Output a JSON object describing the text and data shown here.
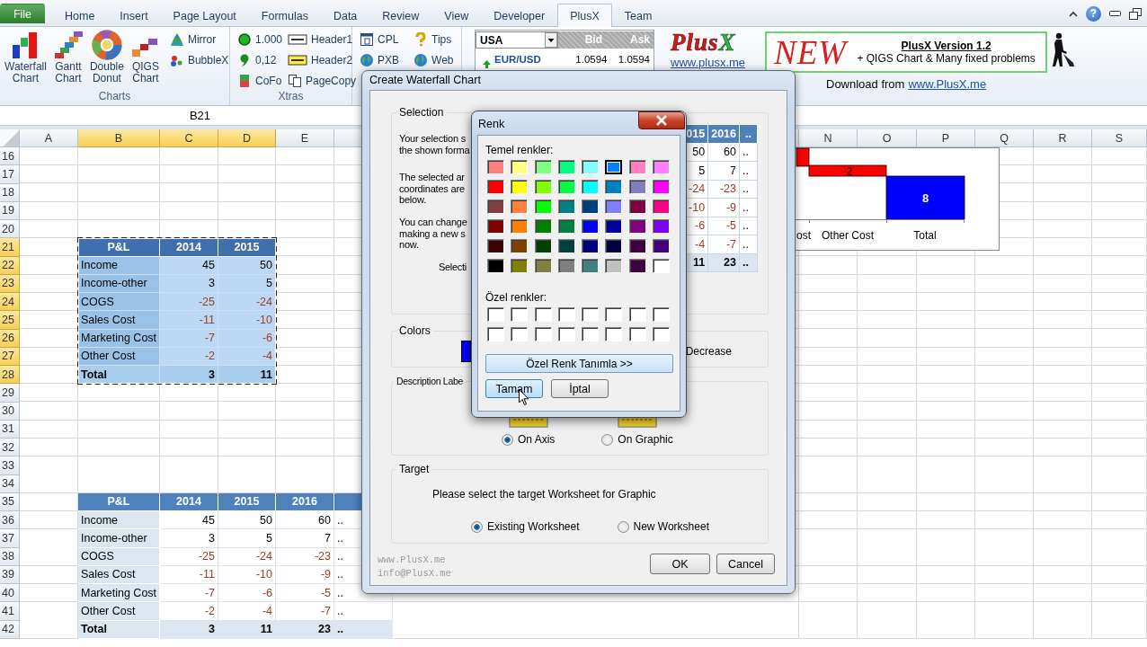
{
  "ribbon": {
    "tabs": [
      {
        "label": "File",
        "kind": "file",
        "selected": false
      },
      {
        "label": "Home",
        "kind": "tab",
        "selected": false
      },
      {
        "label": "Insert",
        "kind": "tab",
        "selected": false
      },
      {
        "label": "Page Layout",
        "kind": "tab",
        "selected": false
      },
      {
        "label": "Formulas",
        "kind": "tab",
        "selected": false
      },
      {
        "label": "Data",
        "kind": "tab",
        "selected": false
      },
      {
        "label": "Review",
        "kind": "tab",
        "selected": false
      },
      {
        "label": "View",
        "kind": "tab",
        "selected": false
      },
      {
        "label": "Developer",
        "kind": "tab",
        "selected": false
      },
      {
        "label": "PlusX",
        "kind": "tab",
        "selected": true
      },
      {
        "label": "Team",
        "kind": "tab",
        "selected": false
      }
    ],
    "help": "?",
    "charts_group": {
      "label": "Charts",
      "large_buttons": [
        "Waterfall Chart",
        "Gantt Chart",
        "Double Donut",
        "QIGS Chart"
      ],
      "small_buttons": [
        "Mirror",
        "BubbleX"
      ]
    },
    "xtras_group": {
      "label": "Xtras",
      "columns": [
        [
          "1.000",
          "0,12",
          "CoFo"
        ],
        [
          "Header1",
          "Header2",
          "PageCopy"
        ]
      ]
    },
    "web_group": {
      "columns": [
        [
          "CPL",
          "PXB"
        ],
        [
          "Tips",
          "Web"
        ]
      ]
    },
    "quote": {
      "market": "USA",
      "columns": [
        "Bid",
        "Ask"
      ],
      "rows": [
        {
          "pair": "EUR/USD",
          "bid": "1.0594",
          "ask": "1.0594"
        }
      ]
    },
    "logo": {
      "name": "PlusX",
      "url": "www.plusx.me"
    },
    "banner": {
      "badge": "NEW",
      "title": "PlusX Version 1.2",
      "subtitle": "+ QIGS Chart & Many fixed problems"
    },
    "download": {
      "prefix": "Download from",
      "link": "www.PlusX.me"
    }
  },
  "name_box": "B21",
  "sheet": {
    "columns": [
      {
        "label": "A",
        "selected": false
      },
      {
        "label": "B",
        "selected": true
      },
      {
        "label": "C",
        "selected": true
      },
      {
        "label": "D",
        "selected": true
      },
      {
        "label": "E",
        "selected": false
      }
    ],
    "columns_right": [
      {
        "label": "N",
        "selected": false
      },
      {
        "label": "O",
        "selected": false
      },
      {
        "label": "P",
        "selected": false
      },
      {
        "label": "Q",
        "selected": false
      },
      {
        "label": "R",
        "selected": false
      },
      {
        "label": "S",
        "selected": false
      }
    ],
    "rows": [
      {
        "label": "16",
        "selected": false
      },
      {
        "label": "17",
        "selected": false
      },
      {
        "label": "18",
        "selected": false
      },
      {
        "label": "19",
        "selected": false
      },
      {
        "label": "20",
        "selected": false
      },
      {
        "label": "21",
        "selected": true
      },
      {
        "label": "22",
        "selected": true
      },
      {
        "label": "23",
        "selected": true
      },
      {
        "label": "24",
        "selected": true
      },
      {
        "label": "25",
        "selected": true
      },
      {
        "label": "26",
        "selected": true
      },
      {
        "label": "27",
        "selected": true
      },
      {
        "label": "28",
        "selected": true
      },
      {
        "label": "29",
        "selected": false
      },
      {
        "label": "30",
        "selected": false
      },
      {
        "label": "31",
        "selected": false
      },
      {
        "label": "32",
        "selected": false
      },
      {
        "label": "33",
        "selected": false
      },
      {
        "label": "34",
        "selected": false
      },
      {
        "label": "35",
        "selected": false
      },
      {
        "label": "36",
        "selected": false
      },
      {
        "label": "37",
        "selected": false
      },
      {
        "label": "38",
        "selected": false
      },
      {
        "label": "39",
        "selected": false
      },
      {
        "label": "40",
        "selected": false
      },
      {
        "label": "41",
        "selected": false
      },
      {
        "label": "42",
        "selected": false
      }
    ],
    "tables": [
      {
        "selected": true,
        "header": [
          "P&L",
          "2014",
          "2015"
        ],
        "rows": [
          {
            "label": "Income",
            "values": [
              "45",
              "50"
            ],
            "negative": false,
            "total": false
          },
          {
            "label": "Income-other",
            "values": [
              "3",
              "5"
            ],
            "negative": false,
            "total": false
          },
          {
            "label": "COGS",
            "values": [
              "-25",
              "-24"
            ],
            "negative": true,
            "total": false
          },
          {
            "label": "Sales Cost",
            "values": [
              "-11",
              "-10"
            ],
            "negative": true,
            "total": false
          },
          {
            "label": "Marketing Cost",
            "values": [
              "-7",
              "-6"
            ],
            "negative": true,
            "total": false
          },
          {
            "label": "Other Cost",
            "values": [
              "-2",
              "-4"
            ],
            "negative": true,
            "total": false
          },
          {
            "label": "Total",
            "values": [
              "3",
              "11"
            ],
            "negative": false,
            "total": true
          }
        ]
      },
      {
        "selected": false,
        "header": [
          "P&L",
          "2014",
          "2015",
          "2016"
        ],
        "rows": [
          {
            "label": "Income",
            "values": [
              "45",
              "50",
              "60",
              ".."
            ],
            "negative": false,
            "total": false
          },
          {
            "label": "Income-other",
            "values": [
              "3",
              "5",
              "7",
              ".."
            ],
            "negative": false,
            "total": false
          },
          {
            "label": "COGS",
            "values": [
              "-25",
              "-24",
              "-23",
              ".."
            ],
            "negative": true,
            "total": false
          },
          {
            "label": "Sales Cost",
            "values": [
              "-11",
              "-10",
              "-9",
              ".."
            ],
            "negative": true,
            "total": false
          },
          {
            "label": "Marketing Cost",
            "values": [
              "-7",
              "-6",
              "-5",
              ".."
            ],
            "negative": true,
            "total": false
          },
          {
            "label": "Other Cost",
            "values": [
              "-2",
              "-4",
              "-7",
              ".."
            ],
            "negative": true,
            "total": false
          },
          {
            "label": "Total",
            "values": [
              "3",
              "11",
              "23",
              ".."
            ],
            "negative": false,
            "total": true
          }
        ]
      }
    ]
  },
  "chart_preview": {
    "categories": [
      "ost",
      "Other Cost",
      "Total"
    ],
    "bars": [
      {
        "kind": "decrease"
      },
      {
        "kind": "decrease",
        "value_label": "-2"
      },
      {
        "kind": "total",
        "value_label": "8"
      }
    ]
  },
  "dialog": {
    "title": "Create Waterfall Chart",
    "selection": {
      "legend": "Selection",
      "paragraphs": [
        "Your selection s\nthe shown forma",
        "The selected ar\ncoordinates are\nbelow.",
        "You can change\nmaking a new s\nnow."
      ],
      "select_label": "Selecti",
      "preview": {
        "header": [
          "015",
          "2016",
          ".."
        ],
        "rows": [
          {
            "values": [
              "50",
              "60",
              ".."
            ],
            "negative": false,
            "total": false
          },
          {
            "values": [
              "5",
              "7",
              ".."
            ],
            "negative": false,
            "total": false
          },
          {
            "values": [
              "-24",
              "-23",
              ".."
            ],
            "negative": true,
            "total": false
          },
          {
            "values": [
              "-10",
              "-9",
              ".."
            ],
            "negative": true,
            "total": false
          },
          {
            "values": [
              "-6",
              "-5",
              ".."
            ],
            "negative": true,
            "total": false
          },
          {
            "values": [
              "-4",
              "-7",
              ".."
            ],
            "negative": true,
            "total": false
          },
          {
            "values": [
              "11",
              "23",
              ".."
            ],
            "negative": false,
            "total": true
          }
        ]
      }
    },
    "colors": {
      "legend": "Colors",
      "label": "Decrease"
    },
    "description": {
      "legend": "Description Labe",
      "options": [
        {
          "label": "On Axis",
          "selected": true
        },
        {
          "label": "On Graphic",
          "selected": false
        }
      ]
    },
    "target": {
      "legend": "Target",
      "prompt": "Please select the target Worksheet for Graphic",
      "options": [
        {
          "label": "Existing Worksheet",
          "selected": true
        },
        {
          "label": "New Worksheet",
          "selected": false
        }
      ]
    },
    "footer": [
      "www.PlusX.me",
      "info@PlusX.me"
    ],
    "buttons": [
      "OK",
      "Cancel"
    ]
  },
  "color_picker": {
    "title": "Renk",
    "basic_label": "Temel renkler:",
    "basic_rows": [
      {
        "swatches": [
          {
            "color": "#ff8080",
            "selected": false
          },
          {
            "color": "#ffff80",
            "selected": false
          },
          {
            "color": "#80ff80",
            "selected": false
          },
          {
            "color": "#00ff80",
            "selected": false
          },
          {
            "color": "#80ffff",
            "selected": false
          },
          {
            "color": "#0080ff",
            "selected": true
          },
          {
            "color": "#ff80c0",
            "selected": false
          },
          {
            "color": "#ff80ff",
            "selected": false
          }
        ]
      },
      {
        "swatches": [
          {
            "color": "#ff0000",
            "selected": false
          },
          {
            "color": "#ffff00",
            "selected": false
          },
          {
            "color": "#80ff00",
            "selected": false
          },
          {
            "color": "#00ff40",
            "selected": false
          },
          {
            "color": "#00ffff",
            "selected": false
          },
          {
            "color": "#0080c0",
            "selected": false
          },
          {
            "color": "#8080c0",
            "selected": false
          },
          {
            "color": "#ff00ff",
            "selected": false
          }
        ]
      },
      {
        "swatches": [
          {
            "color": "#804040",
            "selected": false
          },
          {
            "color": "#ff8040",
            "selected": false
          },
          {
            "color": "#00ff00",
            "selected": false
          },
          {
            "color": "#008080",
            "selected": false
          },
          {
            "color": "#004080",
            "selected": false
          },
          {
            "color": "#8080ff",
            "selected": false
          },
          {
            "color": "#800040",
            "selected": false
          },
          {
            "color": "#ff0080",
            "selected": false
          }
        ]
      },
      {
        "swatches": [
          {
            "color": "#800000",
            "selected": false
          },
          {
            "color": "#ff8000",
            "selected": false
          },
          {
            "color": "#008000",
            "selected": false
          },
          {
            "color": "#008040",
            "selected": false
          },
          {
            "color": "#0000ff",
            "selected": false
          },
          {
            "color": "#0000a0",
            "selected": false
          },
          {
            "color": "#800080",
            "selected": false
          },
          {
            "color": "#8000ff",
            "selected": false
          }
        ]
      },
      {
        "swatches": [
          {
            "color": "#400000",
            "selected": false
          },
          {
            "color": "#804000",
            "selected": false
          },
          {
            "color": "#004000",
            "selected": false
          },
          {
            "color": "#004040",
            "selected": false
          },
          {
            "color": "#000080",
            "selected": false
          },
          {
            "color": "#000040",
            "selected": false
          },
          {
            "color": "#400040",
            "selected": false
          },
          {
            "color": "#400080",
            "selected": false
          }
        ]
      },
      {
        "swatches": [
          {
            "color": "#000000",
            "selected": false
          },
          {
            "color": "#808000",
            "selected": false
          },
          {
            "color": "#808040",
            "selected": false
          },
          {
            "color": "#808080",
            "selected": false
          },
          {
            "color": "#408080",
            "selected": false
          },
          {
            "color": "#c0c0c0",
            "selected": false
          },
          {
            "color": "#400040",
            "selected": false
          },
          {
            "color": "#ffffff",
            "selected": false
          }
        ]
      }
    ],
    "custom_label": "Özel renkler:",
    "define_button": "Özel Renk Tanımla >>",
    "buttons": [
      {
        "label": "Tamam",
        "focused": true
      },
      {
        "label": "İptal",
        "focused": false
      }
    ]
  }
}
